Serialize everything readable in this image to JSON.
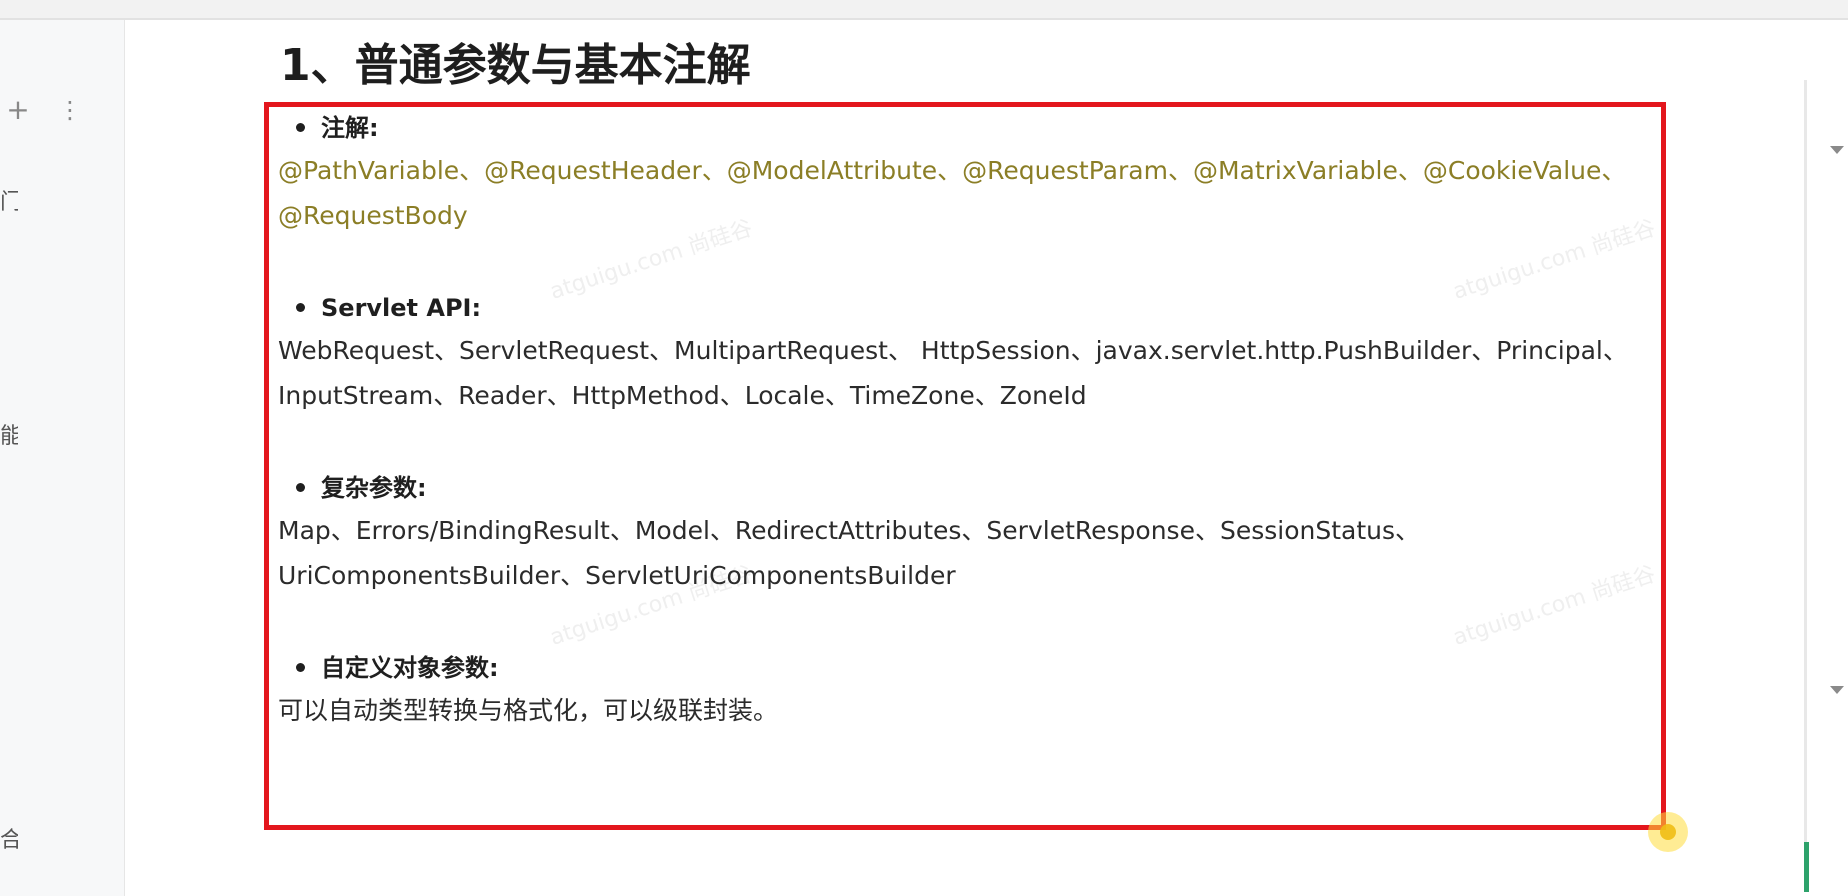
{
  "doc": {
    "title": "1、普通参数与基本注解",
    "sections": [
      {
        "heading": "注解:",
        "lines": [
          "@PathVariable、@RequestHeader、@ModelAttribute、@RequestParam、@MatrixVariable、@CookieValue、",
          "@RequestBody"
        ]
      },
      {
        "heading": "Servlet API:",
        "lines": [
          "WebRequest、ServletRequest、MultipartRequest、 HttpSession、javax.servlet.http.PushBuilder、Principal、",
          "InputStream、Reader、HttpMethod、Locale、TimeZone、ZoneId"
        ]
      },
      {
        "heading": "复杂参数:",
        "lines": [
          "Map、Errors/BindingResult、Model、RedirectAttributes、ServletResponse、SessionStatus、",
          "UriComponentsBuilder、ServletUriComponentsBuilder"
        ]
      },
      {
        "heading": "自定义对象参数:",
        "lines": [
          "可以自动类型转换与格式化，可以级联封装。"
        ]
      }
    ]
  },
  "sidebar": {
    "add_symbol": "+",
    "more_symbol": "⋮",
    "fragments": [
      "门",
      "能",
      "合"
    ]
  },
  "watermark": "atguigu.com 尚硅谷",
  "colors": {
    "annotation_text": "#8b7e26",
    "highlight_box": "#e3161d",
    "progress_accent": "#2da26b"
  }
}
